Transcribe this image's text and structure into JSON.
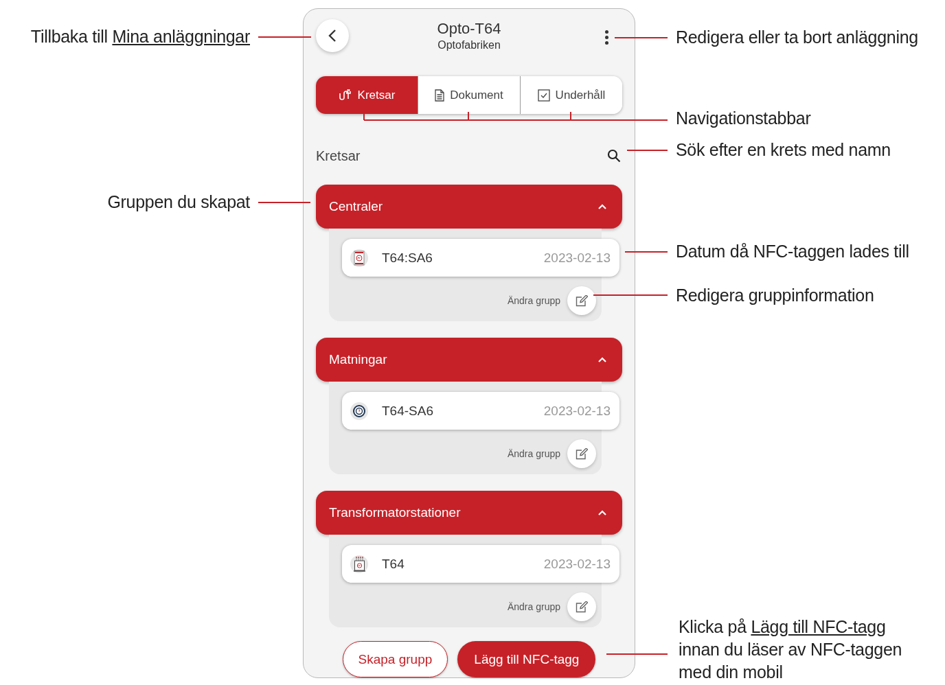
{
  "header": {
    "title": "Opto-T64",
    "subtitle": "Optofabriken"
  },
  "tabs": [
    {
      "label": "Kretsar",
      "selected": true,
      "kind": "circuit"
    },
    {
      "label": "Dokument",
      "selected": false,
      "kind": "document"
    },
    {
      "label": "Underhåll",
      "selected": false,
      "kind": "checklist"
    }
  ],
  "section_title": "Kretsar",
  "groups": [
    {
      "name": "Centraler",
      "expanded": true,
      "items": [
        {
          "kind": "panel",
          "name": "T64:SA6",
          "date": "2023-02-13"
        }
      ],
      "edit_label": "Ändra grupp"
    },
    {
      "name": "Matningar",
      "expanded": true,
      "items": [
        {
          "kind": "meter",
          "name": "T64-SA6",
          "date": "2023-02-13"
        }
      ],
      "edit_label": "Ändra grupp"
    },
    {
      "name": "Transformatorstationer",
      "expanded": true,
      "items": [
        {
          "kind": "transformer",
          "name": "T64",
          "date": "2023-02-13"
        }
      ],
      "edit_label": "Ändra grupp"
    }
  ],
  "buttons": [
    {
      "label": "Skapa grupp",
      "kind": "secondary"
    },
    {
      "label": "Lägg till NFC-tagg",
      "kind": "primary"
    }
  ],
  "annotations": [
    {
      "text": "Tillbaka till",
      "link": "Mina anläggningar"
    },
    {
      "text": "Gruppen du skapat"
    },
    {
      "text": "Redigera eller ta bort anläggning"
    },
    {
      "text": "Navigationstabbar"
    },
    {
      "text": "Sök efter en krets med namn"
    },
    {
      "text": "Datum då NFC-taggen lades till"
    },
    {
      "text": "Redigera gruppinformation"
    },
    {
      "text": "Klicka på",
      "link": "Lägg till NFC-tagg",
      "after": "innan du läser av NFC-taggen med din mobil"
    }
  ]
}
